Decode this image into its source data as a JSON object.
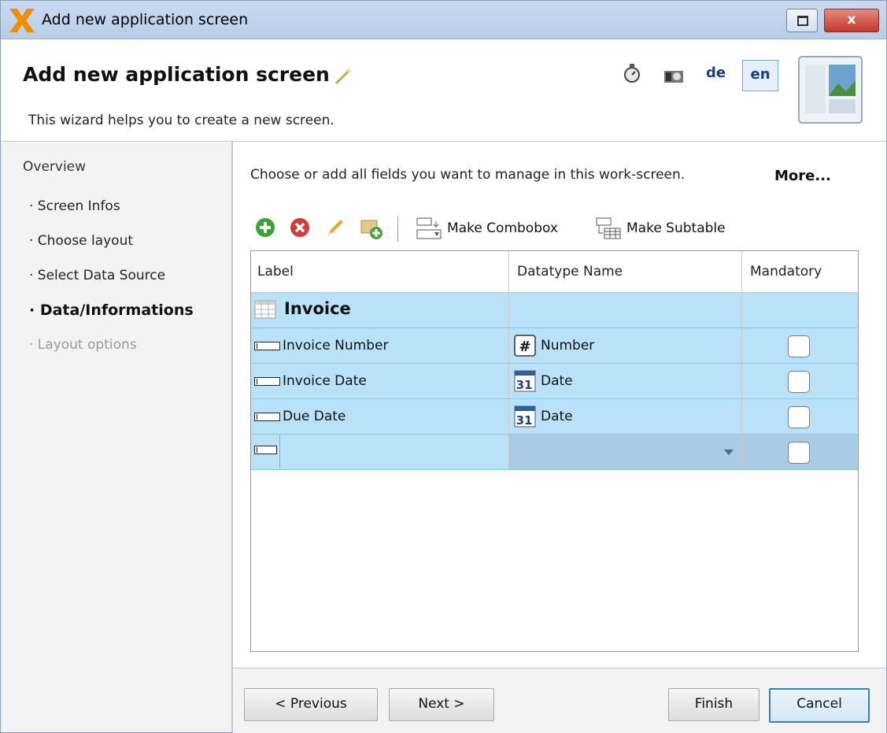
{
  "window": {
    "title": "Add new application screen",
    "close_label": "x"
  },
  "header": {
    "title": "Add new application screen",
    "description": "This wizard helps you to create a new screen.",
    "languages": [
      "de",
      "en"
    ],
    "active_language": "en"
  },
  "sidebar": {
    "overview_label": "Overview",
    "items": [
      {
        "label": "· Screen Infos",
        "state": "normal"
      },
      {
        "label": "· Choose layout",
        "state": "normal"
      },
      {
        "label": "· Select Data Source",
        "state": "normal"
      },
      {
        "label": "· Data/Informations",
        "state": "active"
      },
      {
        "label": "· Layout options",
        "state": "disabled"
      }
    ]
  },
  "main": {
    "instruction": "Choose or add all fields you want to manage in this work-screen.",
    "more_label": "More...",
    "toolbar": {
      "add_icon": "add-icon",
      "remove_icon": "remove-icon",
      "edit_icon": "pencil-icon",
      "import_icon": "import-icon",
      "make_combobox_label": "Make Combobox",
      "make_subtable_label": "Make Subtable"
    },
    "grid": {
      "columns": [
        "Label",
        "Datatype Name",
        "Mandatory"
      ],
      "group_label": "Invoice",
      "rows": [
        {
          "label": "Invoice Number",
          "datatype": "Number",
          "datatype_icon": "hash-icon",
          "mandatory": false
        },
        {
          "label": "Invoice Date",
          "datatype": "Date",
          "datatype_icon": "calendar-icon",
          "mandatory": false
        },
        {
          "label": "Due Date",
          "datatype": "Date",
          "datatype_icon": "calendar-icon",
          "mandatory": false
        }
      ],
      "new_row": {
        "label": "",
        "datatype": "",
        "mandatory": false
      }
    }
  },
  "footer": {
    "previous_label": "< Previous",
    "next_label": "Next >",
    "finish_label": "Finish",
    "cancel_label": "Cancel"
  },
  "colors": {
    "accent": "#f28c00",
    "row_bg": "#b9e2f8",
    "title_text": "#1a3c8c"
  }
}
